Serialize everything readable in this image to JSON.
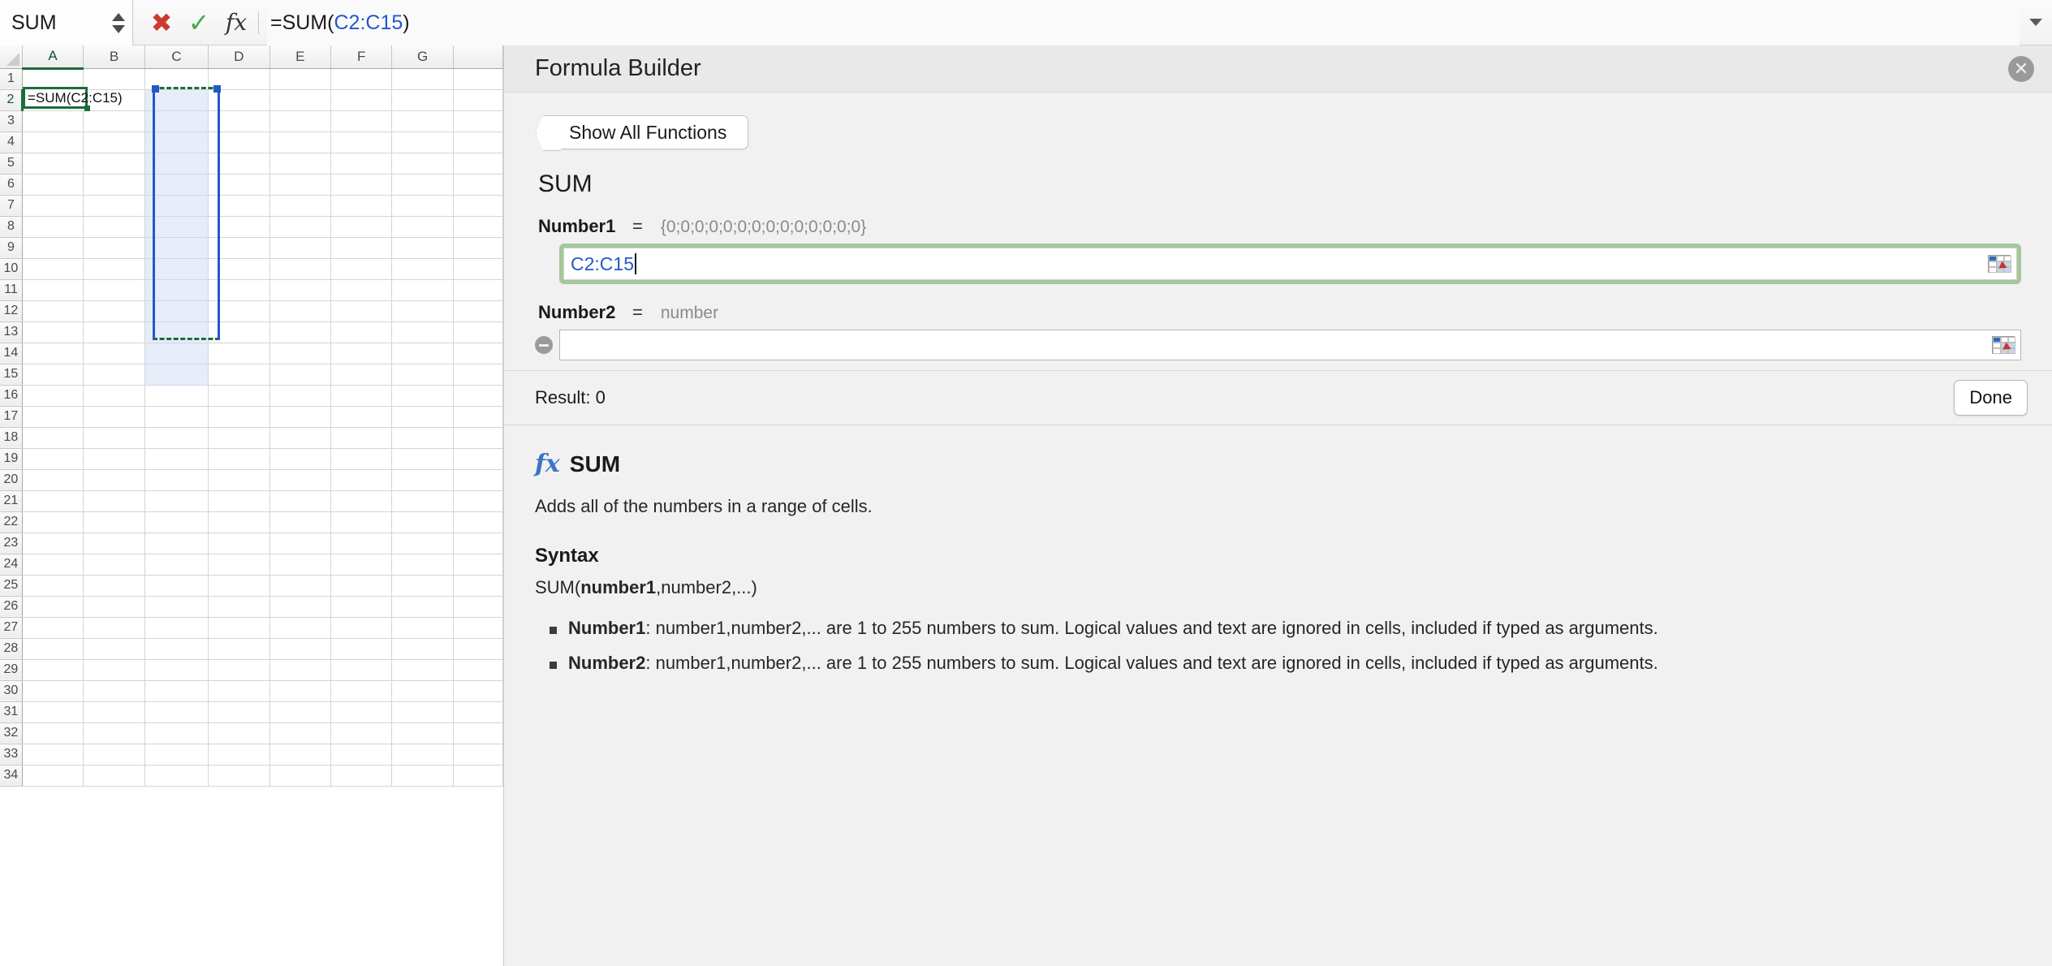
{
  "formula_bar": {
    "name_box_value": "SUM",
    "cancel_icon": "x-icon",
    "confirm_icon": "check-icon",
    "fx_label": "fx",
    "formula_prefix": "=SUM(",
    "formula_ref": "C2:C15",
    "formula_suffix": ")"
  },
  "grid": {
    "columns": [
      "A",
      "B",
      "C",
      "D",
      "E",
      "F",
      "G"
    ],
    "rows": [
      1,
      2,
      3,
      4,
      5,
      6,
      7,
      8,
      9,
      10,
      11,
      12,
      13,
      14,
      15,
      16,
      17,
      18,
      19,
      20,
      21,
      22,
      23,
      24,
      25,
      26,
      27,
      28,
      29,
      30,
      31,
      32,
      33,
      34
    ],
    "selected_column": "A",
    "selected_row": 2,
    "active_cell_text": "=SUM(C2:C15)",
    "range_selection": "C2:C15",
    "range_column_index": 2,
    "range_row_start": 2,
    "range_row_end": 15
  },
  "panel": {
    "title": "Formula Builder",
    "close_icon": "close-icon",
    "show_all_functions": "Show All Functions",
    "function_name": "SUM",
    "arguments": [
      {
        "label": "Number1",
        "equals": "=",
        "value": "{0;0;0;0;0;0;0;0;0;0;0;0;0;0}",
        "input_value": "C2:C15",
        "focused": true,
        "removable": false
      },
      {
        "label": "Number2",
        "equals": "=",
        "value": "number",
        "input_value": "",
        "focused": false,
        "removable": true
      }
    ],
    "add_argument_icon": "plus-icon",
    "remove_argument_icon": "minus-icon",
    "range_picker_icon": "range-picker-icon",
    "result_label": "Result: 0",
    "done_label": "Done"
  },
  "help": {
    "fx_icon": "fx-icon",
    "function_name": "SUM",
    "description": "Adds all of the numbers in a range of cells.",
    "syntax_heading": "Syntax",
    "syntax_prefix": "SUM(",
    "syntax_bold": "number1",
    "syntax_suffix": ",number2,...)",
    "args": [
      {
        "name": "Number1",
        "text": ": number1,number2,... are 1 to 255 numbers to sum. Logical values and text are ignored in cells, included if typed as arguments."
      },
      {
        "name": "Number2",
        "text": ": number1,number2,... are 1 to 255 numbers to sum. Logical values and text are ignored in cells, included if typed as arguments."
      }
    ]
  },
  "colors": {
    "selection_green": "#1d6b3a",
    "reference_blue": "#2458c9",
    "focus_ring_green": "#a5c79a",
    "range_fill": "#e7edf8"
  }
}
